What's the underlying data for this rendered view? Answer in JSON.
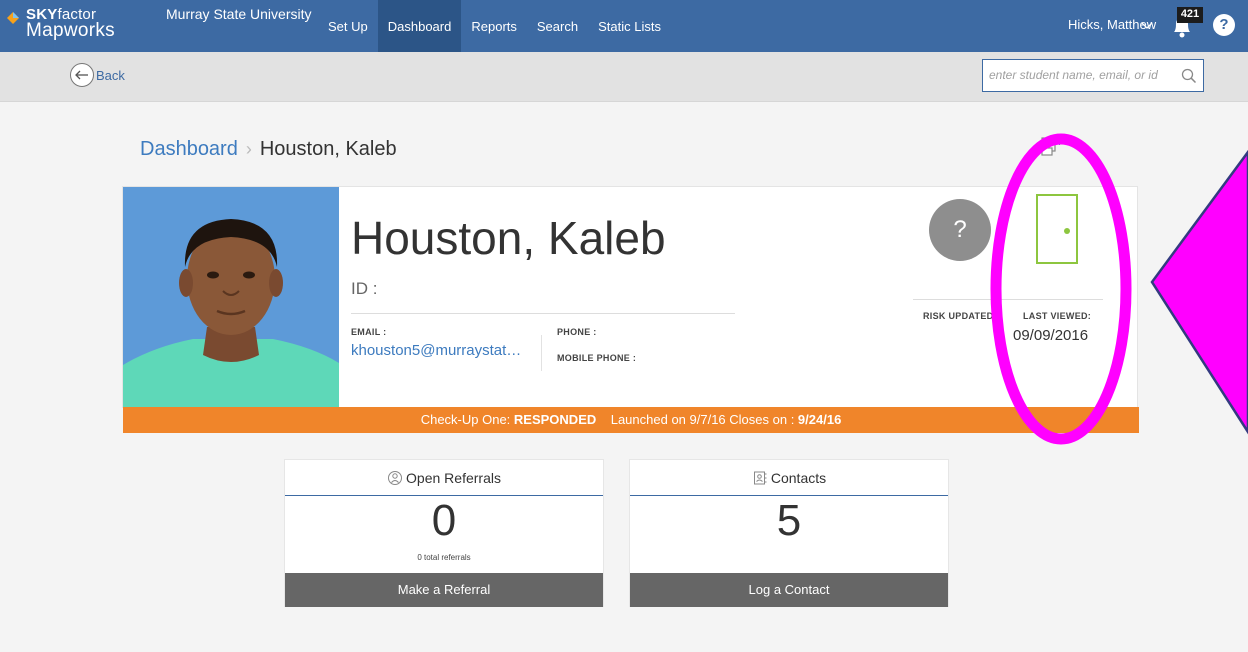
{
  "app": {
    "brand_top_bold": "SKY",
    "brand_top_light": "factor",
    "brand_bottom": "Mapworks",
    "institution": "Murray State University"
  },
  "nav": {
    "items": [
      {
        "label": "Set Up",
        "active": false
      },
      {
        "label": "Dashboard",
        "active": true
      },
      {
        "label": "Reports",
        "active": false
      },
      {
        "label": "Search",
        "active": false
      },
      {
        "label": "Static Lists",
        "active": false
      }
    ],
    "user_name": "Hicks, Matthew",
    "notification_count": "421",
    "help_label": "?"
  },
  "subbar": {
    "back_label": "Back",
    "search_placeholder": "enter student name, email, or id"
  },
  "breadcrumb": {
    "parent": "Dashboard",
    "current": "Houston, Kaleb",
    "print_label": "Pri"
  },
  "student": {
    "name": "Houston, Kaleb",
    "id_label": "ID :",
    "email_label": "EMAIL :",
    "email_value": "khouston5@murraystat…",
    "phone_label": "PHONE :",
    "mobile_label": "MOBILE PHONE :",
    "risk_symbol": "?",
    "risk_label": "RISK UPDATED",
    "last_viewed_label": "LAST VIEWED:",
    "last_viewed_value": "09/09/2016"
  },
  "survey": {
    "prefix": "Check-Up One: ",
    "status": "RESPONDED",
    "launched": "Launched on 9/7/16 Closes on : ",
    "closes": "9/24/16"
  },
  "widgets": {
    "referrals": {
      "title": "Open Referrals",
      "count": "0",
      "subtitle": "0 total referrals",
      "button": "Make a Referral"
    },
    "contacts": {
      "title": "Contacts",
      "count": "5",
      "button": "Log a Contact"
    }
  },
  "colors": {
    "nav_bg": "#3d6aa3",
    "nav_active": "#2c5587",
    "link_blue": "#3d7bbf",
    "survey_orange": "#f0852a",
    "door_green": "#8dc63f",
    "annotation_magenta": "#ff00ff"
  }
}
